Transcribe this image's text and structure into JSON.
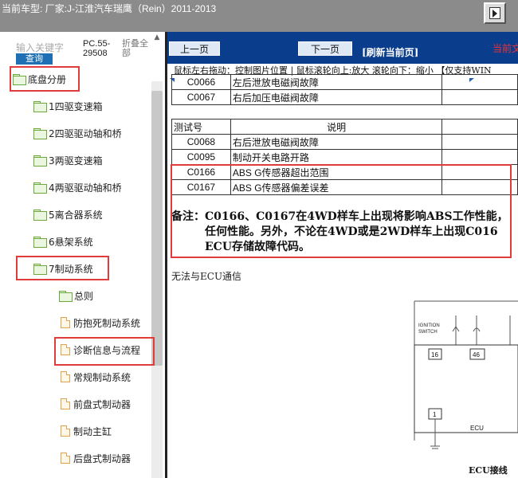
{
  "topbar": {
    "title": "当前车型:  厂家:J-江淮汽车瑞鹰（Rein）2011-2013"
  },
  "sidebar": {
    "search_placeholder": "输入关键字",
    "query_label": "查询",
    "model_code": "PC.55-29508",
    "collapse_all_label": "折叠全部",
    "root_label": "底盘分册",
    "items": [
      {
        "label": "1四驱变速箱",
        "icon": "folder-icon"
      },
      {
        "label": "2四驱驱动轴和桥",
        "icon": "folder-icon"
      },
      {
        "label": "3两驱变速箱",
        "icon": "folder-icon"
      },
      {
        "label": "4两驱驱动轴和桥",
        "icon": "folder-icon"
      },
      {
        "label": "5离合器系统",
        "icon": "folder-icon"
      },
      {
        "label": "6悬架系统",
        "icon": "folder-icon"
      },
      {
        "label": "7制动系统",
        "icon": "folder-open-icon"
      }
    ],
    "sub_items": [
      {
        "label": "总则",
        "icon": "folder-icon"
      },
      {
        "label": "防抱死制动系统",
        "icon": "document-icon"
      },
      {
        "label": "诊断信息与流程",
        "icon": "document-icon"
      },
      {
        "label": "常规制动系统",
        "icon": "document-icon"
      },
      {
        "label": "前盘式制动器",
        "icon": "document-icon"
      },
      {
        "label": "制动主缸",
        "icon": "document-icon"
      },
      {
        "label": "后盘式制动器",
        "icon": "document-icon"
      }
    ]
  },
  "toolbar": {
    "prev_label": "上一页",
    "next_label": "下一页",
    "refresh_label": "[刷新当前页]",
    "current_label": "当前文"
  },
  "hint": "鼠标左右拖动：控制图片位置 | 鼠标滚轮向上:放大  滚轮向下：缩小 【仅支持WIN",
  "document": {
    "table1": [
      {
        "code": "C0066",
        "desc": "左后泄放电磁阀故障"
      },
      {
        "code": "C0067",
        "desc": "右后加压电磁阀故障"
      }
    ],
    "table2_header": {
      "code": "测试号",
      "desc": "说明"
    },
    "table2": [
      {
        "code": "C0068",
        "desc": "右后泄放电磁阀故障"
      },
      {
        "code": "C0095",
        "desc": "制动开关电路开路"
      },
      {
        "code": "C0166",
        "desc": "ABS G传感器超出范围"
      },
      {
        "code": "C0167",
        "desc": "ABS G传感器偏差误差"
      }
    ],
    "note_line1": "备注：C0166、C0167在4WD样车上出现将影响ABS工作性能，",
    "note_line2": "任何性能。另外，不论在4WD或是2WD样车上出现C016",
    "note_line3": "ECU存储故障代码。",
    "subhead": "无法与ECU通信",
    "diagram": {
      "ignition_label_1": "IGNITION",
      "ignition_label_2": "SWITCH",
      "pin_16": "16",
      "pin_46": "46",
      "pin_1": "1",
      "ecu_label": "ECU",
      "caption": "ECU接线"
    }
  }
}
